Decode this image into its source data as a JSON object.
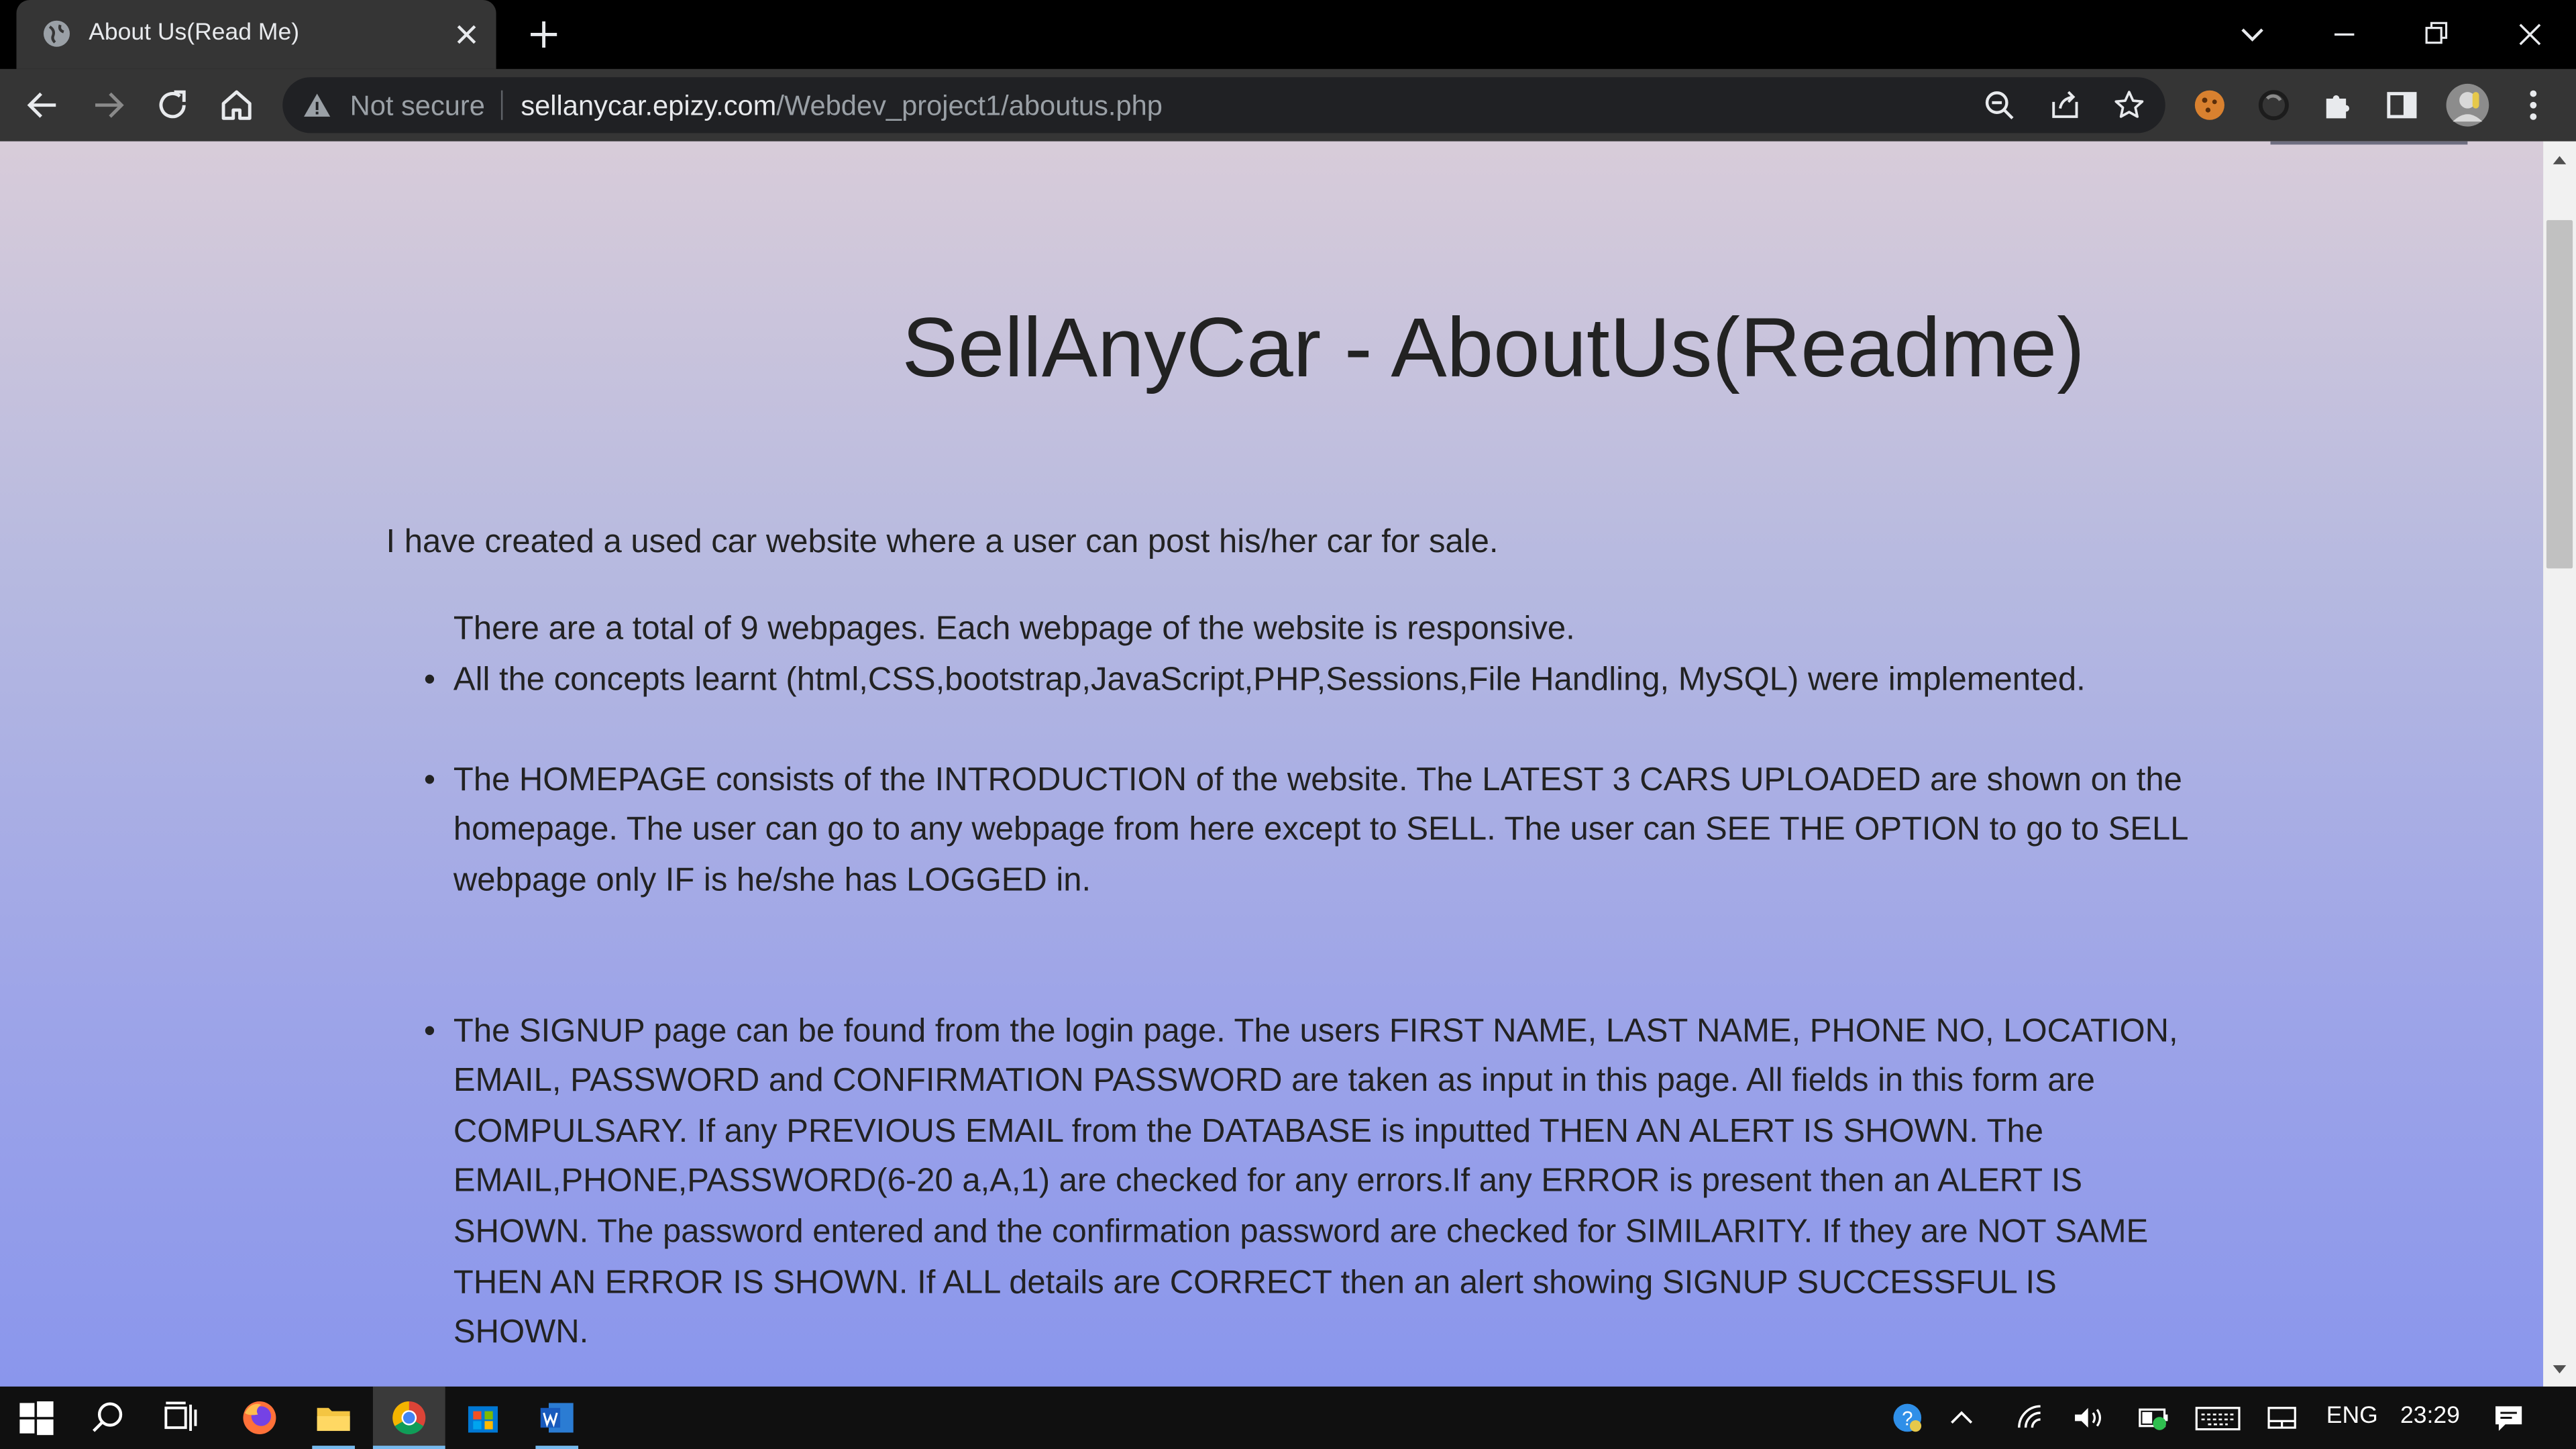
{
  "browser": {
    "tab": {
      "title": "About Us(Read Me)"
    },
    "omnibox": {
      "security_label": "Not secure",
      "url_host": "sellanycar.epizy.com",
      "url_path": "/Webdev_project1/aboutus.php"
    }
  },
  "page": {
    "title": "SellAnyCar - AboutUs(Readme)",
    "intro": "I have created a used car website where a user can post his/her car for sale.",
    "list_plain": "There are a total of 9 webpages. Each webpage of the website is responsive.",
    "bullets": [
      "All the concepts learnt (html,CSS,bootstrap,JavaScript,PHP,Sessions,File Handling, MySQL) were implemented.",
      "The HOMEPAGE consists of the INTRODUCTION of the website. The LATEST 3 CARS UPLOADED are shown on the homepage. The user can go to any webpage from here except to SELL. The user can SEE THE OPTION to go to SELL webpage only IF is he/she has LOGGED in.",
      "The SIGNUP page can be found from the login page. The users FIRST NAME, LAST NAME, PHONE NO, LOCATION, EMAIL, PASSWORD and CONFIRMATION PASSWORD are taken as input in this page. All fields in this form are COMPULSARY. If any PREVIOUS EMAIL from the DATABASE is inputted THEN AN ALERT IS SHOWN. The EMAIL,PHONE,PASSWORD(6-20 a,A,1) are checked for any errors.If any ERROR is present then an ALERT IS SHOWN. The password entered and the confirmation password are checked for SIMILARITY. If they are NOT SAME THEN AN ERROR IS SHOWN. If ALL details are CORRECT then an alert showing SIGNUP SUCCESSFUL IS SHOWN."
    ],
    "bullet_char": "•"
  },
  "taskbar": {
    "language": "ENG",
    "time": "23:29"
  },
  "colors": {
    "tab_strip": "#000000",
    "toolbar": "#353535",
    "omnibox": "#202124",
    "page_gradient_top": "#d8ccd9",
    "page_gradient_bottom": "#8a96ec",
    "taskbar": "#101010"
  },
  "icons": {
    "tab_favicon": "globe-icon",
    "security": "warning-triangle-icon"
  }
}
